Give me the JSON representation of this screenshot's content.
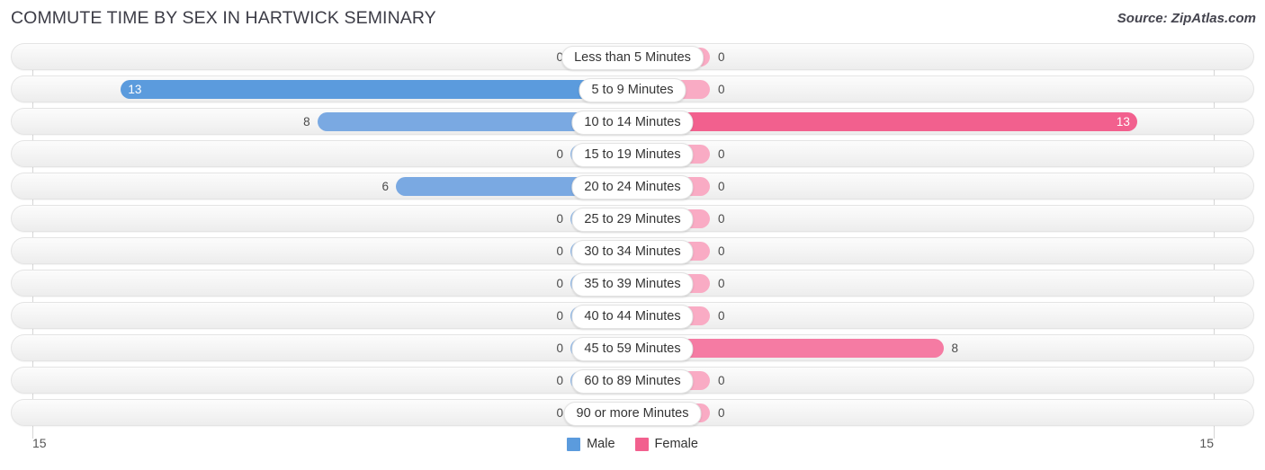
{
  "header": {
    "title": "COMMUTE TIME BY SEX IN HARTWICK SEMINARY",
    "source": "Source: ZipAtlas.com"
  },
  "axis": {
    "left_tick": "15",
    "right_tick": "15"
  },
  "legend": {
    "items": [
      {
        "label": "Male",
        "color": "#5b9bdd"
      },
      {
        "label": "Female",
        "color": "#f2608e"
      }
    ]
  },
  "colors": {
    "male_max": "#5b9bdd",
    "male_mid": "#7aa9e2",
    "male_zero": "#91b9e8",
    "female_max": "#f2608e",
    "female_mid": "#f57ba3",
    "female_zero": "#f9abc4",
    "track": "#f4f4f4",
    "title": "#3c3c46"
  },
  "chart_data": {
    "type": "bar",
    "orientation": "horizontal-diverging",
    "title": "COMMUTE TIME BY SEX IN HARTWICK SEMINARY",
    "xlabel": "",
    "ylabel": "",
    "xlim": [
      15,
      15
    ],
    "grid": false,
    "legend_position": "bottom-center",
    "categories": [
      "Less than 5 Minutes",
      "5 to 9 Minutes",
      "10 to 14 Minutes",
      "15 to 19 Minutes",
      "20 to 24 Minutes",
      "25 to 29 Minutes",
      "30 to 34 Minutes",
      "35 to 39 Minutes",
      "40 to 44 Minutes",
      "45 to 59 Minutes",
      "60 to 89 Minutes",
      "90 or more Minutes"
    ],
    "series": [
      {
        "name": "Male",
        "values": [
          0,
          13,
          8,
          0,
          6,
          0,
          0,
          0,
          0,
          0,
          0,
          0
        ]
      },
      {
        "name": "Female",
        "values": [
          0,
          0,
          13,
          0,
          0,
          0,
          0,
          0,
          0,
          8,
          0,
          0
        ]
      }
    ]
  },
  "rows": [
    {
      "label": "Less than 5 Minutes",
      "male": "0",
      "female": "0"
    },
    {
      "label": "5 to 9 Minutes",
      "male": "13",
      "female": "0"
    },
    {
      "label": "10 to 14 Minutes",
      "male": "8",
      "female": "13"
    },
    {
      "label": "15 to 19 Minutes",
      "male": "0",
      "female": "0"
    },
    {
      "label": "20 to 24 Minutes",
      "male": "6",
      "female": "0"
    },
    {
      "label": "25 to 29 Minutes",
      "male": "0",
      "female": "0"
    },
    {
      "label": "30 to 34 Minutes",
      "male": "0",
      "female": "0"
    },
    {
      "label": "35 to 39 Minutes",
      "male": "0",
      "female": "0"
    },
    {
      "label": "40 to 44 Minutes",
      "male": "0",
      "female": "0"
    },
    {
      "label": "45 to 59 Minutes",
      "male": "0",
      "female": "8"
    },
    {
      "label": "60 to 89 Minutes",
      "male": "0",
      "female": "0"
    },
    {
      "label": "90 or more Minutes",
      "male": "0",
      "female": "0"
    }
  ]
}
